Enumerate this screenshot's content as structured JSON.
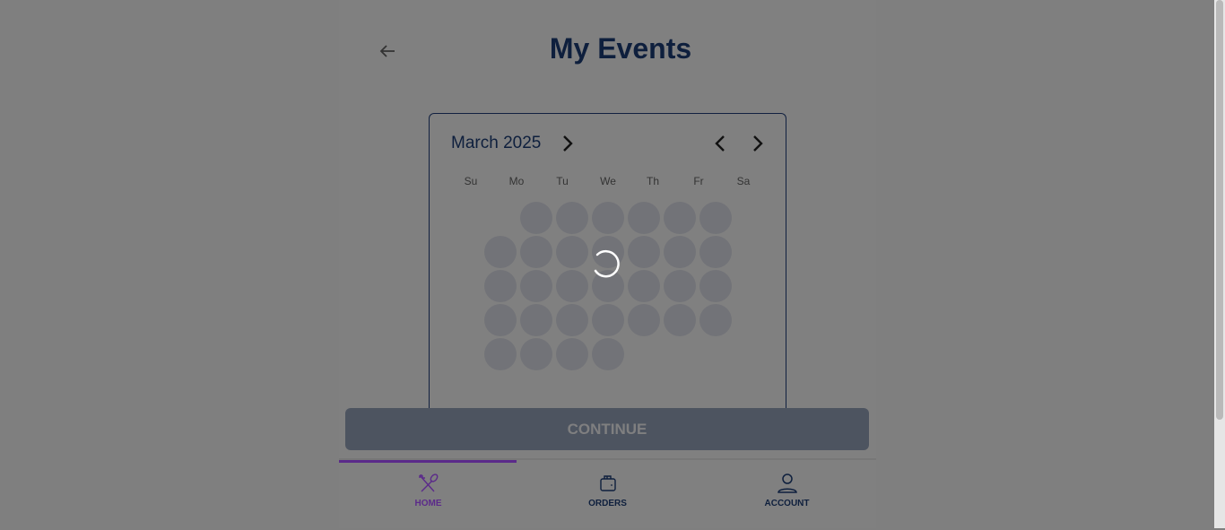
{
  "header": {
    "title": "My Events",
    "back_icon": "arrow-left-icon"
  },
  "calendar": {
    "month_label": "March 2025",
    "weekdays": [
      "Su",
      "Mo",
      "Tu",
      "We",
      "Th",
      "Fr",
      "Sa"
    ],
    "loading": true
  },
  "continue_label": "CONTINUE",
  "nav": {
    "active_color": "#5b2a8a",
    "items": [
      {
        "label": "HOME",
        "icon": "utensils-icon",
        "active": true
      },
      {
        "label": "ORDERS",
        "icon": "wallet-icon",
        "active": false
      },
      {
        "label": "ACCOUNT",
        "icon": "user-icon",
        "active": false
      }
    ]
  }
}
